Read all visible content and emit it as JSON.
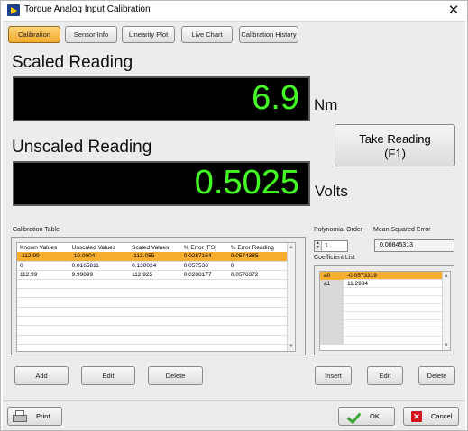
{
  "window": {
    "title": "Torque Analog Input Calibration",
    "close_glyph": "✕"
  },
  "tabs": [
    {
      "label": "Calibration",
      "active": true
    },
    {
      "label": "Sensor Info",
      "active": false
    },
    {
      "label": "Linearity Plot",
      "active": false
    },
    {
      "label": "Live Chart",
      "active": false
    },
    {
      "label": "Calibration History",
      "active": false
    }
  ],
  "scaled": {
    "label": "Scaled Reading",
    "value": "6.9",
    "unit": "Nm"
  },
  "unscaled": {
    "label": "Unscaled Reading",
    "value": "0.5025",
    "unit": "Volts"
  },
  "take_reading": {
    "line1": "Take Reading",
    "line2": "(F1)"
  },
  "calibration_table": {
    "label": "Calibration Table",
    "columns": [
      "Known Values",
      "Unscaled Values",
      "Scaled Values",
      "% Error (FS)",
      "% Error Reading"
    ],
    "rows": [
      [
        "-112.99",
        "-10.0004",
        "-113.055",
        "0.0287164",
        "0.0574385"
      ],
      [
        "0",
        "0.0165811",
        "0.130024",
        "0.057536",
        "0"
      ],
      [
        "112.99",
        "9.99899",
        "112.925",
        "0.0288177",
        "0.0576372"
      ]
    ],
    "selected_row": 0
  },
  "table_buttons": {
    "add": "Add",
    "edit": "Edit",
    "delete": "Delete"
  },
  "polynomial_order": {
    "label": "Polynomial Order",
    "value": "1"
  },
  "mse": {
    "label": "Mean Squared Error",
    "value": "0.00845313"
  },
  "coefficients": {
    "label": "Coefficient List",
    "rows": [
      {
        "name": "a0",
        "value": "-0.0573319"
      },
      {
        "name": "a1",
        "value": "11.2984"
      }
    ],
    "selected_row": 0
  },
  "coef_buttons": {
    "insert": "Insert",
    "edit": "Edit",
    "delete": "Delete"
  },
  "footer": {
    "print": "Print",
    "ok": "OK",
    "cancel": "Cancel"
  },
  "colors": {
    "display_text": "#44ff22",
    "active_tab": "#f2a92c",
    "selected_row": "#f7ad2e",
    "cancel_icon": "#d4161f",
    "ok_icon": "#3aa635"
  },
  "icons": [
    "app-icon",
    "close-icon",
    "printer-icon",
    "check-icon",
    "cancel-icon",
    "scroll-up-icon",
    "scroll-down-icon",
    "spinner-icon"
  ]
}
